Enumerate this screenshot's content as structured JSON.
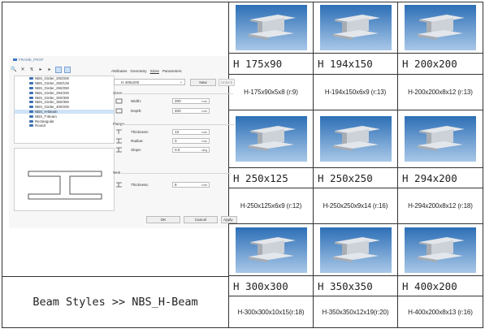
{
  "dialog": {
    "title": "FRAME_PROF",
    "toolbar": [
      "🔍",
      "✕",
      "↯",
      "▸",
      "▸"
    ],
    "tree_items": [
      {
        "label": "NBS_Girder_200/200",
        "selected": false
      },
      {
        "label": "NBS_Girder_250/125",
        "selected": false
      },
      {
        "label": "NBS_Girder_250/250",
        "selected": false
      },
      {
        "label": "NBS_Girder_294/200",
        "selected": false
      },
      {
        "label": "NBS_Girder_300/300",
        "selected": false
      },
      {
        "label": "NBS_Girder_350/350",
        "selected": false
      },
      {
        "label": "NBS_Girder_400/200",
        "selected": false
      },
      {
        "label": "NBS_H-Beam",
        "selected": true
      },
      {
        "label": "NBS_T-Beam",
        "selected": false
      },
      {
        "label": "Rectangular",
        "selected": false
      },
      {
        "label": "Round",
        "selected": false
      }
    ],
    "tabs": [
      "Attributes",
      "Geometry",
      "Sizes",
      "Parameters"
    ],
    "profile_value": "H 400x200",
    "new_label": "New",
    "unlock_label": "Unlock",
    "sizes_label": "Sizes",
    "width_label": "Width:",
    "width_value": "200",
    "depth_label": "Depth:",
    "depth_value": "400",
    "flange_label": "Flange",
    "thickness_label": "Thickness:",
    "flange_thickness_value": "13",
    "radius_label": "Radius:",
    "radius_value": "0",
    "slope_label": "Slope:",
    "slope_value": "0.0",
    "web_label": "Web",
    "web_thickness_label": "Thickness:",
    "web_thickness_value": "8",
    "unit_mm": "mm",
    "unit_deg": "deg",
    "ok_label": "OK",
    "cancel_label": "Cancel",
    "apply_label": "Apply"
  },
  "caption": "Beam Styles >> NBS_H-Beam",
  "beams": [
    {
      "name": "H 175x90",
      "spec": "H-175x90x5x8 (r:9)"
    },
    {
      "name": "H 194x150",
      "spec": "H-194x150x6x9 (r:13)"
    },
    {
      "name": "H 200x200",
      "spec": "H-200x200x8x12 (r:13)"
    },
    {
      "name": "H 250x125",
      "spec": "H-250x125x6x9 (r:12)"
    },
    {
      "name": "H 250x250",
      "spec": "H-250x250x9x14 (r:16)"
    },
    {
      "name": "H 294x200",
      "spec": "H-294x200x8x12 (r:18)"
    },
    {
      "name": "H 300x300",
      "spec": "H-300x300x10x15(r:18)"
    },
    {
      "name": "H 350x350",
      "spec": "H-350x350x12x19(r:20)"
    },
    {
      "name": "H 400x200",
      "spec": "H-400x200x8x13 (r:16)"
    }
  ],
  "colors": {
    "sky_top": "#2d6fb6",
    "sky_bottom": "#a9c8e8",
    "beam_face": "#e3e6ea",
    "beam_shade": "#a8adb3"
  }
}
